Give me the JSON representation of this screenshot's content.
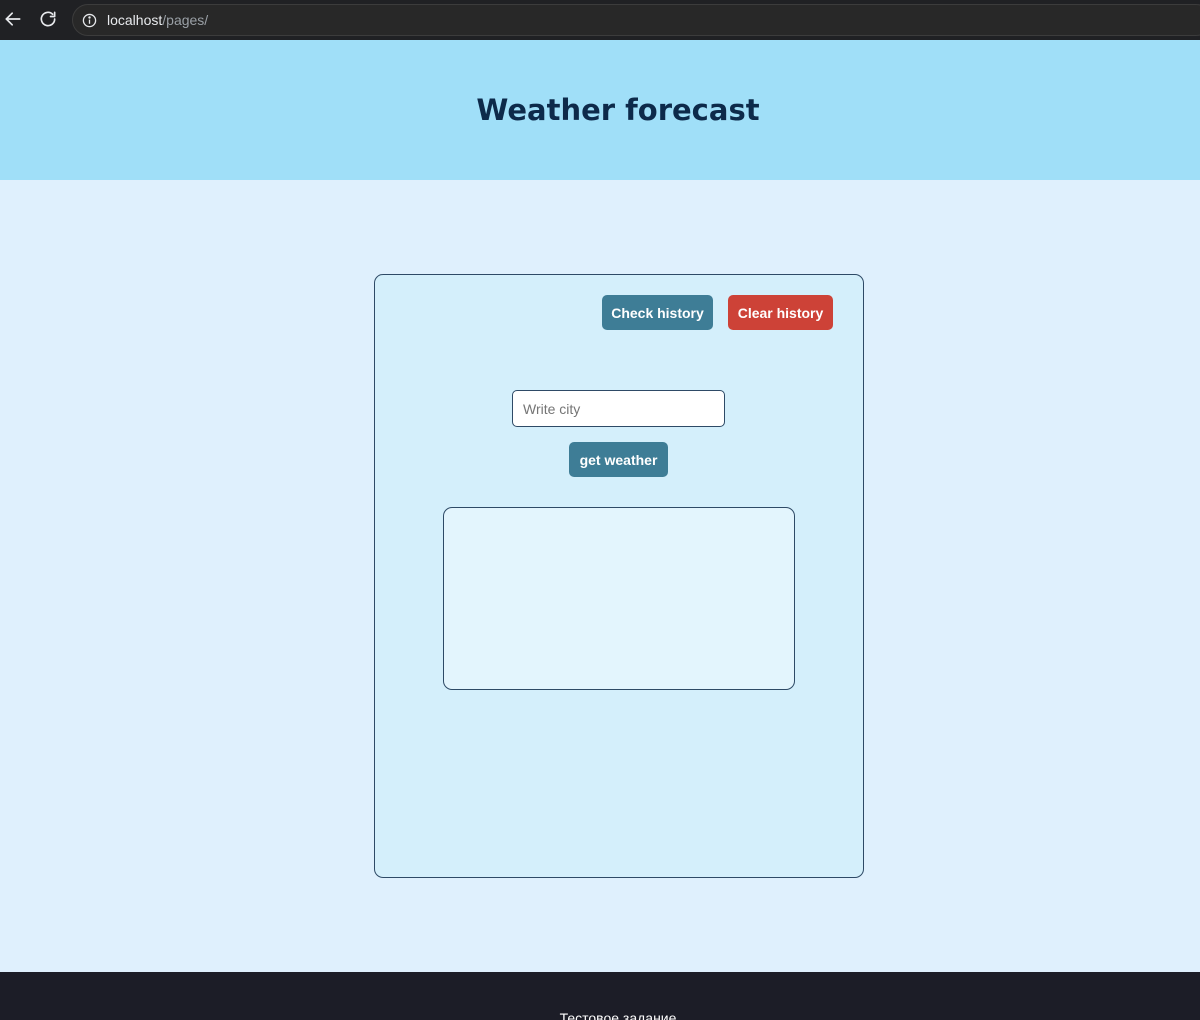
{
  "browser": {
    "url_host": "localhost",
    "url_path": "/pages/"
  },
  "header": {
    "title": "Weather forecast"
  },
  "card": {
    "check_history_label": "Check history",
    "clear_history_label": "Clear history",
    "city_placeholder": "Write city",
    "city_value": "",
    "get_weather_label": "get weather",
    "result": ""
  },
  "footer": {
    "text": "Тестовое задание"
  },
  "colors": {
    "header_bg": "#a0dff8",
    "page_bg": "#dff0fd",
    "primary_button": "#3e7d96",
    "danger_button": "#cd4237",
    "footer_bg": "#1c1d27",
    "title_text": "#0d2a4a"
  },
  "icons": {
    "back": "arrow-left-icon",
    "reload": "reload-icon",
    "site_info": "info-icon"
  }
}
